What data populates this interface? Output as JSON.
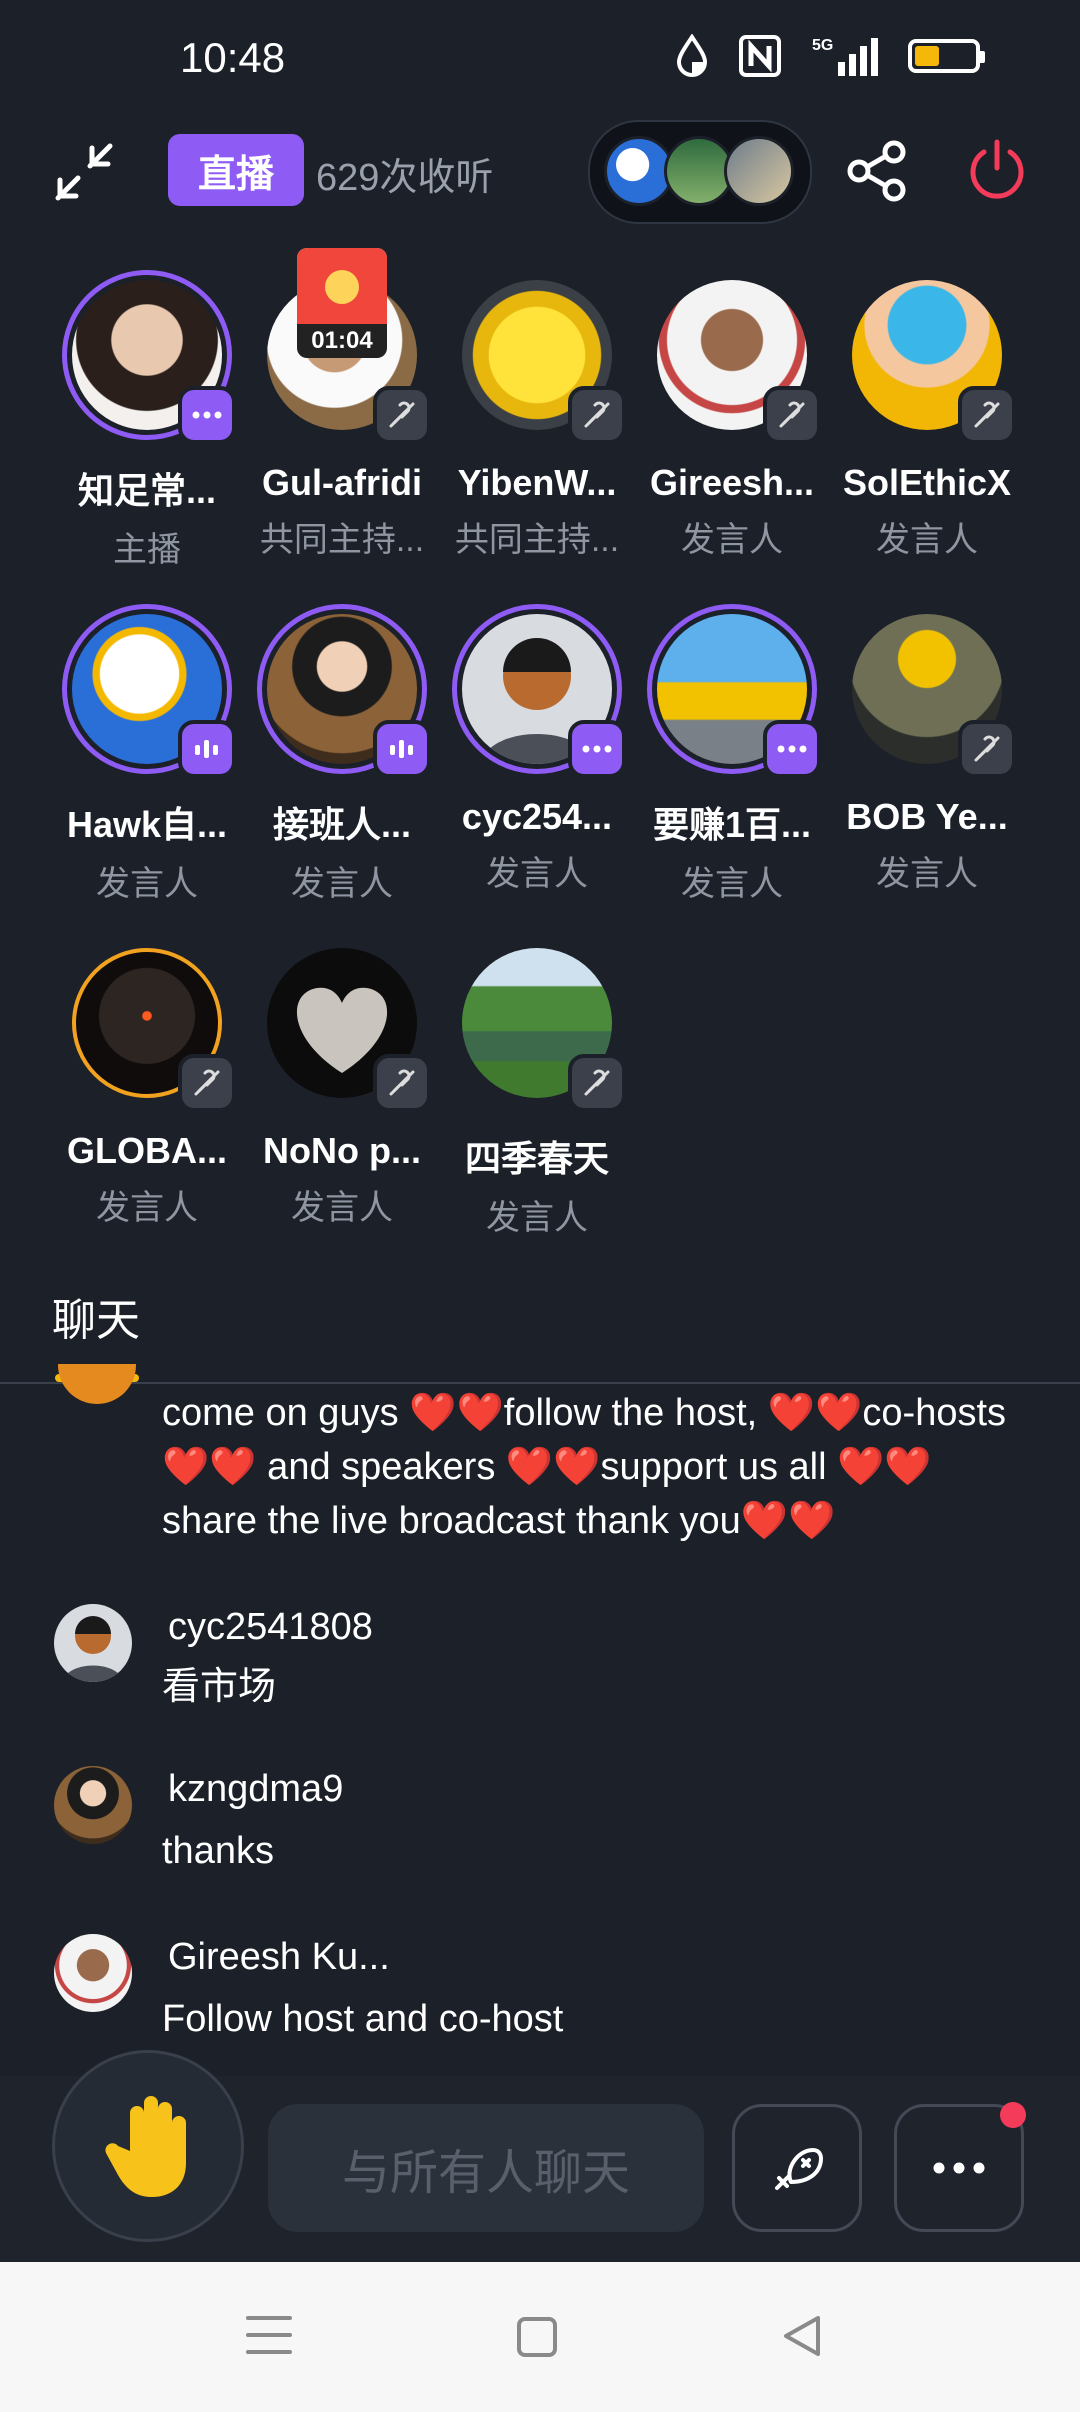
{
  "status_bar": {
    "time": "10:48"
  },
  "header": {
    "live_badge": "直播",
    "listen_count": "629次收听"
  },
  "participants": [
    {
      "name": "知足常...",
      "role": "主播",
      "mic": "more"
    },
    {
      "name": "Gul-afridi",
      "role": "共同主持...",
      "mic": "muted",
      "timer": "01:04"
    },
    {
      "name": "YibenW...",
      "role": "共同主持...",
      "mic": "muted"
    },
    {
      "name": "Gireesh...",
      "role": "发言人",
      "mic": "muted"
    },
    {
      "name": "SolEthicX",
      "role": "发言人",
      "mic": "muted"
    },
    {
      "name": "Hawk自...",
      "role": "发言人",
      "mic": "speaking"
    },
    {
      "name": "接班人...",
      "role": "发言人",
      "mic": "speaking"
    },
    {
      "name": "cyc254...",
      "role": "发言人",
      "mic": "more"
    },
    {
      "name": "要赚1百...",
      "role": "发言人",
      "mic": "more"
    },
    {
      "name": "BOB Ye...",
      "role": "发言人",
      "mic": "muted"
    },
    {
      "name": "GLOBA...",
      "role": "发言人",
      "mic": "muted"
    },
    {
      "name": "NoNo p...",
      "role": "发言人",
      "mic": "muted"
    },
    {
      "name": "四季春天",
      "role": "发言人",
      "mic": "muted"
    }
  ],
  "chat": {
    "title": "聊天",
    "messages": [
      {
        "name": "",
        "text": "come on guys ❤️❤️follow the host, ❤️❤️co-hosts❤️❤️ and speakers ❤️❤️support us all ❤️❤️ share the live broadcast thank you❤️❤️"
      },
      {
        "name": "cyc2541808",
        "text": "看市场"
      },
      {
        "name": "kzngdma9",
        "text": "thanks"
      },
      {
        "name": "Gireesh Ku...",
        "text": "Follow host and co-host"
      }
    ],
    "input_placeholder": "与所有人聊天"
  },
  "colors": {
    "accent": "#8e5cf5",
    "background": "#1b2029",
    "leave": "#f43b5a"
  }
}
